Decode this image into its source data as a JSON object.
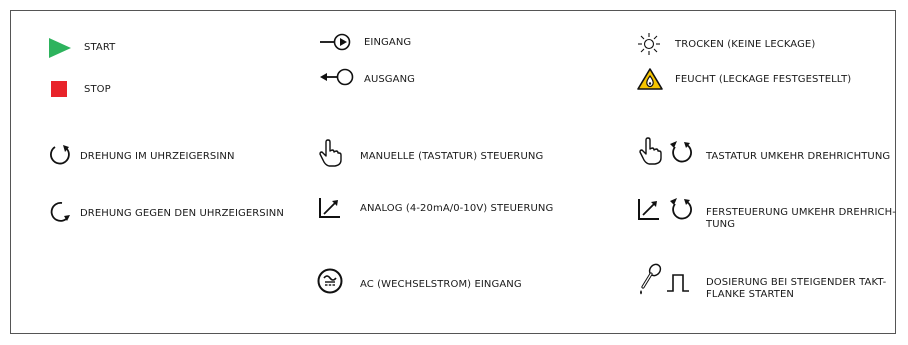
{
  "legend": {
    "start": {
      "label": "START",
      "icon": "play-icon",
      "color": "#2db35d"
    },
    "stop": {
      "label": "STOP",
      "icon": "stop-icon",
      "color": "#e8232a"
    },
    "cw": {
      "label": "DREHUNG IM UHRZEIGERSINN",
      "icon": "rotate-clockwise-icon"
    },
    "ccw": {
      "label": "DREHUNG GEGEN DEN UHRZEIGERSINN",
      "icon": "rotate-counterclockwise-icon"
    },
    "input": {
      "label": "EINGANG",
      "icon": "input-arrow-icon"
    },
    "output": {
      "label": "AUSGANG",
      "icon": "output-arrow-icon"
    },
    "manual": {
      "label": "MANUELLE (TASTATUR) STEUERUNG",
      "icon": "hand-pointer-icon"
    },
    "analog": {
      "label": "ANALOG (4-20mA/0-10V) STEUERUNG",
      "icon": "analog-control-icon"
    },
    "ac": {
      "label": "AC (WECHSELSTROM) EINGANG",
      "icon": "ac-input-icon"
    },
    "dry": {
      "label": "TROCKEN (KEINE LECKAGE)",
      "icon": "sun-icon"
    },
    "wet": {
      "label": "FEUCHT (LECKAGE FESTGESTELLT)",
      "icon": "leak-warning-icon",
      "color": "#f5c400"
    },
    "keypad_reverse": {
      "label": "TASTATUR UMKEHR DREHRICHTUNG",
      "icon": "hand-reverse-icon"
    },
    "remote_reverse": {
      "label_line1": "FERSTEUERUNG UMKEHR DREHRICH-",
      "label_line2": "TUNG",
      "icon": "analog-reverse-icon"
    },
    "dosing": {
      "label_line1": "DOSIERUNG BEI STEIGENDER TAKT-",
      "label_line2": "FLANKE STARTEN",
      "icon": "pipette-pulse-icon"
    }
  }
}
